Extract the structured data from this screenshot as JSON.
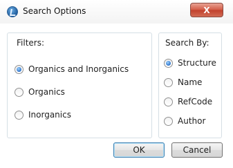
{
  "window": {
    "title": "Search Options",
    "close_glyph": "X"
  },
  "filters": {
    "legend": "Filters:",
    "options": [
      {
        "label": "Organics and Inorganics",
        "checked": true
      },
      {
        "label": "Organics",
        "checked": false
      },
      {
        "label": "Inorganics",
        "checked": false
      }
    ]
  },
  "search_by": {
    "legend": "Search By:",
    "options": [
      {
        "label": "Structure",
        "checked": true
      },
      {
        "label": "Name",
        "checked": false
      },
      {
        "label": "RefCode",
        "checked": false
      },
      {
        "label": "Author",
        "checked": false
      }
    ]
  },
  "buttons": {
    "ok": "OK",
    "cancel": "Cancel"
  },
  "colors": {
    "close_button": "#c0402c",
    "radio_selected": "#2d72c9",
    "group_border": "#d5dfe5"
  },
  "icons": {
    "app": "app-logo-icon",
    "close": "close-icon"
  }
}
